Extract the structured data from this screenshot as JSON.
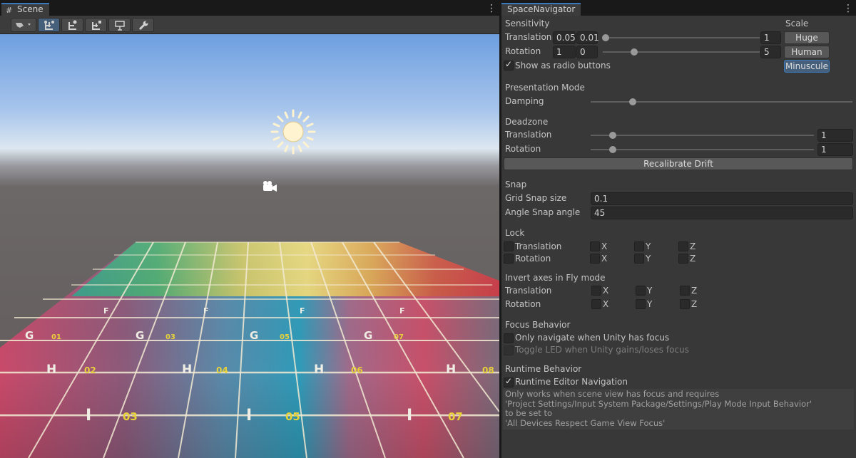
{
  "scene": {
    "tab_label": "Scene",
    "toolbar": [
      "draw-mode",
      "move-tool",
      "rotate-tool",
      "scale-tool",
      "gizmos",
      "settings"
    ]
  },
  "navigator": {
    "tab_label": "SpaceNavigator",
    "sensitivity": {
      "header": "Sensitivity",
      "translation": {
        "label": "Translation",
        "min": "0.05",
        "value": "0.01",
        "max": "1",
        "fraction": 0.02
      },
      "rotation": {
        "label": "Rotation",
        "min": "1",
        "value": "0",
        "max": "5",
        "fraction": 0.2
      },
      "radio_label": "Show as radio buttons",
      "radio_checked": true
    },
    "scale": {
      "header": "Scale",
      "options": [
        "Huge",
        "Human",
        "Minuscule"
      ],
      "selected": "Minuscule"
    },
    "presentation": {
      "header": "Presentation Mode",
      "damping_label": "Damping",
      "damping_fraction": 0.16
    },
    "deadzone": {
      "header": "Deadzone",
      "translation": {
        "label": "Translation",
        "value": "1",
        "fraction": 0.1
      },
      "rotation": {
        "label": "Rotation",
        "value": "1",
        "fraction": 0.1
      },
      "recalibrate": "Recalibrate Drift"
    },
    "snap": {
      "header": "Snap",
      "grid_label": "Grid Snap size",
      "grid_value": "0.1",
      "angle_label": "Angle Snap angle",
      "angle_value": "45"
    },
    "lock": {
      "header": "Lock",
      "translation_label": "Translation",
      "rotation_label": "Rotation",
      "axes": [
        "X",
        "Y",
        "Z"
      ]
    },
    "invert": {
      "header": "Invert axes in Fly mode",
      "translation_label": "Translation",
      "rotation_label": "Rotation",
      "axes": [
        "X",
        "Y",
        "Z"
      ]
    },
    "focus": {
      "header": "Focus Behavior",
      "only_navigate": "Only navigate when Unity has focus",
      "toggle_led": "Toggle LED when Unity gains/loses focus"
    },
    "runtime": {
      "header": "Runtime Behavior",
      "nav_label": "Runtime Editor Navigation",
      "nav_checked": true,
      "help": [
        "Only works when scene view has focus and requires",
        "'Project Settings/Input System Package/Settings/Play Mode Input Behavior'",
        "to be set to",
        "'All Devices Respect Game View Focus'"
      ]
    }
  },
  "colors": {
    "accent": "#3a79bb",
    "selected_button": "#46607c",
    "panel": "#383838"
  }
}
